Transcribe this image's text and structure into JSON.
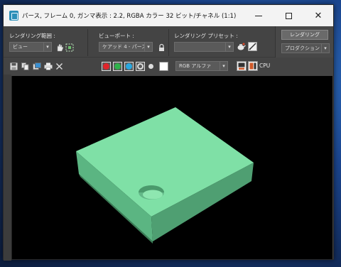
{
  "window": {
    "title": "パース, フレーム 0, ガンマ表示 : 2.2, RGBA カラー 32 ビット/チャネル (1:1)",
    "minimize_glyph": "",
    "close_glyph": "✕"
  },
  "toolbar": {
    "render_area_label": "レンダリング範囲 :",
    "render_area_value": "ビュー",
    "viewport_label": "ビューポート :",
    "viewport_value": "ケアッド 4 - パース",
    "preset_label": "レンダリング プリセット :",
    "preset_value": "",
    "render_button": "レンダリング",
    "production_value": "プロダクション",
    "dropdown_arrow": "▾"
  },
  "toolbar2": {
    "channel_value": "RGB アルファ",
    "cpu_label": "CPU",
    "colors": {
      "red": "#e0252b",
      "green": "#2fb24a",
      "blue": "#2aa8e0",
      "mono": "#dddddd"
    }
  },
  "scene": {
    "background": "#000000",
    "box_top": "#7fe0a6",
    "box_left": "#5bb582",
    "box_right": "#4f9f72",
    "hole": "#6ec493"
  }
}
